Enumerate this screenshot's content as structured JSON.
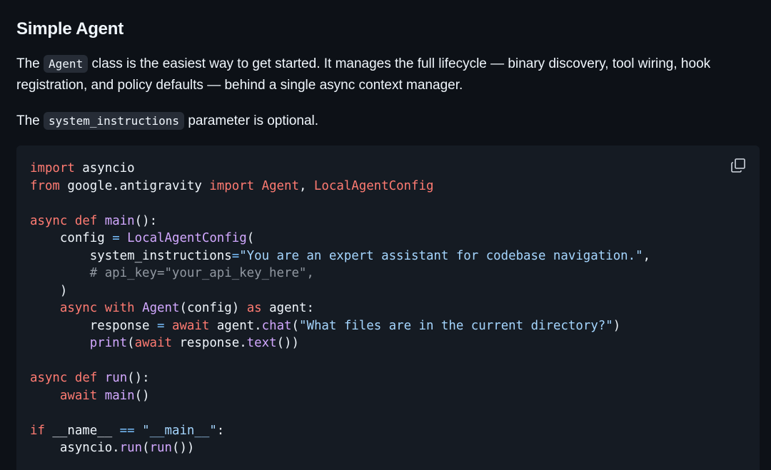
{
  "section": {
    "title": "Simple Agent"
  },
  "paragraph1": {
    "prefix": "The",
    "code": "Agent",
    "text": "class is the easiest way to get started. It manages the full lifecycle — binary discovery, tool wiring, hook registration, and policy defaults — behind a single async context manager."
  },
  "paragraph2": {
    "prefix": "The",
    "code": "system_instructions",
    "text": "parameter is optional."
  },
  "code": {
    "l1_kw": "import",
    "l1_rest": " asyncio",
    "l2_kw1": "from",
    "l2_mod": " google.antigravity ",
    "l2_kw2": "import",
    "l2_sp": " ",
    "l2_cls1": "Agent",
    "l2_comma": ", ",
    "l2_cls2": "LocalAgentConfig",
    "l4_kw1": "async",
    "l4_sp1": " ",
    "l4_kw2": "def",
    "l4_sp2": " ",
    "l4_fn": "main",
    "l4_rest": "():",
    "l5_ind": "    ",
    "l5_var": "config ",
    "l5_op": "=",
    "l5_sp": " ",
    "l5_cls": "LocalAgentConfig",
    "l5_paren": "(",
    "l6_ind": "        ",
    "l6_arg": "system_instructions",
    "l6_op": "=",
    "l6_str": "\"You are an expert assistant for codebase navigation.\"",
    "l6_comma": ",",
    "l7_ind": "        ",
    "l7_cmt": "# api_key=\"your_api_key_here\",",
    "l8_ind": "    ",
    "l8_paren": ")",
    "l9_ind": "    ",
    "l9_kw1": "async",
    "l9_sp1": " ",
    "l9_kw2": "with",
    "l9_sp2": " ",
    "l9_cls": "Agent",
    "l9_mid": "(config) ",
    "l9_kw3": "as",
    "l9_rest": " agent:",
    "l10_ind": "        ",
    "l10_var": "response ",
    "l10_op": "=",
    "l10_sp": " ",
    "l10_kw": "await",
    "l10_obj": " agent.",
    "l10_fn": "chat",
    "l10_p1": "(",
    "l10_str": "\"What files are in the current directory?\"",
    "l10_p2": ")",
    "l11_ind": "        ",
    "l11_fn": "print",
    "l11_p1": "(",
    "l11_kw": "await",
    "l11_obj": " response.",
    "l11_fn2": "text",
    "l11_p2": "())",
    "l13_kw1": "async",
    "l13_sp1": " ",
    "l13_kw2": "def",
    "l13_sp2": " ",
    "l13_fn": "run",
    "l13_rest": "():",
    "l14_ind": "    ",
    "l14_kw": "await",
    "l14_sp": " ",
    "l14_fn": "main",
    "l14_rest": "()",
    "l16_kw": "if",
    "l16_var": " __name__ ",
    "l16_op": "==",
    "l16_sp": " ",
    "l16_str": "\"__main__\"",
    "l16_colon": ":",
    "l17_ind": "    ",
    "l17_obj": "asyncio.",
    "l17_fn": "run",
    "l17_p1": "(",
    "l17_fn2": "run",
    "l17_p2": "())"
  },
  "copy_button": {
    "icon": "copy-icon"
  },
  "colors": {
    "background": "#0d1117",
    "code_background": "#151b23",
    "keyword": "#ff7b72",
    "function": "#d2a8ff",
    "string": "#a5d6ff",
    "operator": "#79c0ff",
    "comment": "#9198a1",
    "text": "#f0f6fc"
  }
}
